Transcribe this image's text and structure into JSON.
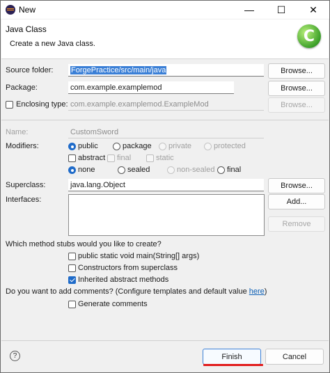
{
  "window": {
    "title": "New"
  },
  "header": {
    "title": "Java Class",
    "description": "Create a new Java class."
  },
  "source_folder": {
    "label": "Source folder:",
    "value": "ForgePractice/src/main/java",
    "browse": "Browse..."
  },
  "package": {
    "label": "Package:",
    "value": "com.example.examplemod",
    "browse": "Browse..."
  },
  "enclosing": {
    "label": "Enclosing type:",
    "value": "com.example.examplemod.ExampleMod",
    "browse": "Browse...",
    "checked": false
  },
  "name": {
    "label": "Name:",
    "value": "CustomSword"
  },
  "modifiers": {
    "label": "Modifiers:",
    "access": [
      "public",
      "package",
      "private",
      "protected"
    ],
    "flags": [
      "abstract",
      "final",
      "static"
    ],
    "inherit": [
      "none",
      "sealed",
      "non-sealed",
      "final"
    ]
  },
  "superclass": {
    "label": "Superclass:",
    "value": "java.lang.Object",
    "browse": "Browse..."
  },
  "interfaces": {
    "label": "Interfaces:",
    "add": "Add...",
    "remove": "Remove"
  },
  "stubs": {
    "question": "Which method stubs would you like to create?",
    "options": [
      {
        "label": "public static void main(String[] args)",
        "checked": false
      },
      {
        "label": "Constructors from superclass",
        "checked": false
      },
      {
        "label": "Inherited abstract methods",
        "checked": true
      }
    ]
  },
  "comments": {
    "question": "Do you want to add comments? (Configure templates and default value ",
    "link": "here",
    "suffix": ")",
    "option": "Generate comments"
  },
  "footer": {
    "help": "?",
    "finish": "Finish",
    "cancel": "Cancel"
  },
  "icons": {
    "app": "eclipse-icon",
    "banner": "java-class-icon",
    "banner_letter": "C",
    "minimize": "—",
    "maximize": "☐",
    "close": "✕"
  },
  "colors": {
    "selection": "#3a7fd6",
    "accent": "#1f6bc9",
    "highlight": "#e11a1a",
    "link": "#0b5fb5"
  }
}
